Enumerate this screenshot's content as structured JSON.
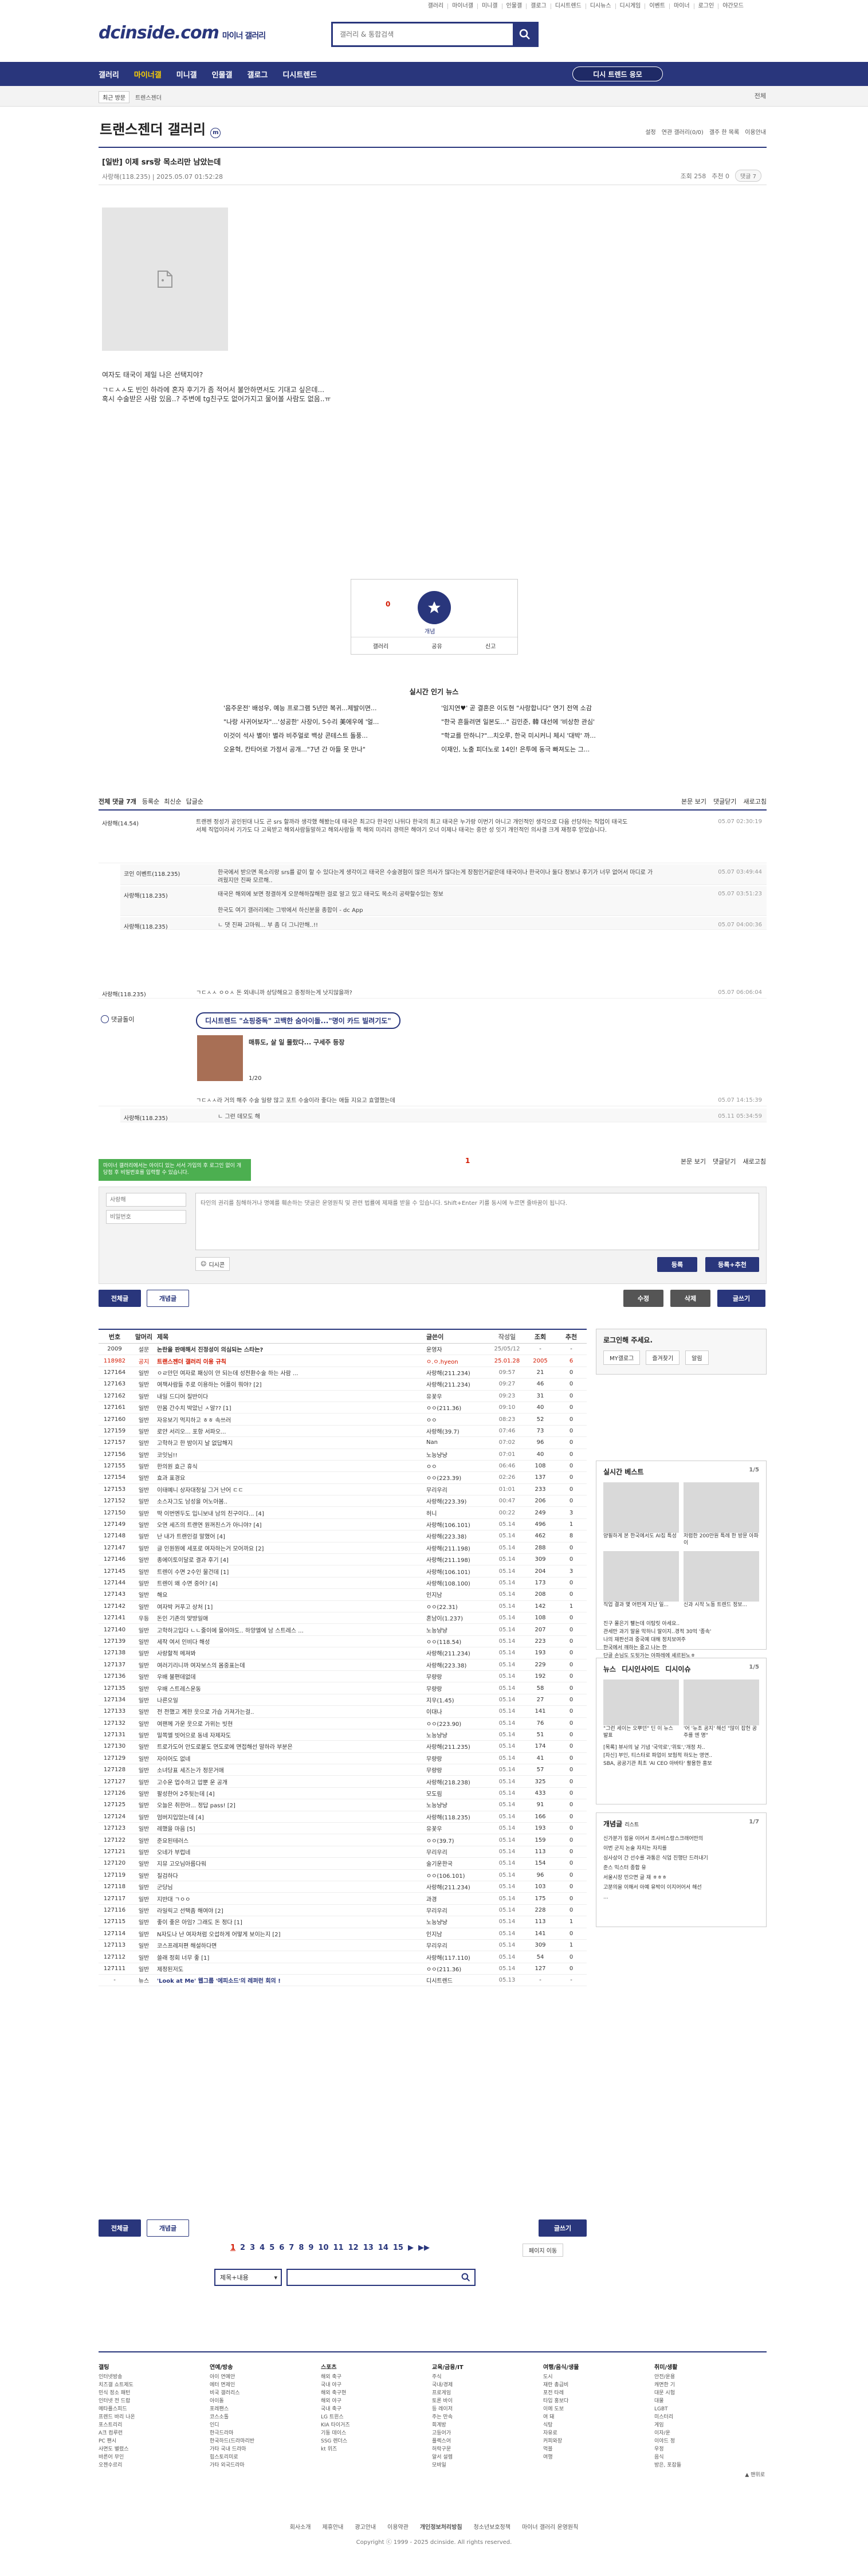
{
  "topmenu": [
    "갤러리",
    "마이너갤",
    "미니갤",
    "인물갤",
    "갤로그",
    "디시트렌드",
    "디시뉴스",
    "디시게임",
    "이벤트",
    "마이너",
    "로그인",
    "야간모드"
  ],
  "logo": {
    "text": "dcinside.com",
    "sub": "마이너 갤러리"
  },
  "search": {
    "placeholder": "갤러리 & 통합검색"
  },
  "gnb": {
    "items": [
      "갤러리",
      "마이너갤",
      "미니갤",
      "인물갤",
      "갤로그",
      "디시트렌드"
    ],
    "right": "디시 트렌드 응모"
  },
  "subbar": {
    "left": [
      "최근 방문",
      "트렌스젠더"
    ],
    "right": "전체"
  },
  "gallery": {
    "title": "트랜스젠더 갤러리",
    "tools": [
      "설정",
      "연관 갤러리(0/0)",
      "갤주 한 목록",
      "이용안내"
    ]
  },
  "post": {
    "title": "[일반] 이제 srs랑 목소리만 남았는데",
    "author": "사랑해(118.235)",
    "date": "2025.05.07 01:52:28",
    "views": "조회 258",
    "recs": "추천 0",
    "cmt": "댓글 7",
    "body": [
      "여자도 태국이 제일 나은 선택지야?",
      "ㄱㄷㅅㅅ도 빈인 하라에 혼자 후기가 좀 적어서 불안하면서도 기대고 싶은데...",
      "혹시 수술받은 사람 있음..? 주변에 tg친구도 없어가지고 물어볼 사람도 없음..ㅠ"
    ],
    "rec_count": "0",
    "rec_label": "개념",
    "actions": [
      "갤러리",
      "공유",
      "신고"
    ]
  },
  "news": {
    "title": "실시간 인기 뉴스",
    "items": [
      "'음주운전' 배성우, 예능 프로그램 5년만 복귀...제발이면...",
      "'임지연♥' 곧 결혼은 이도현 \"사랑합니다\" 연기 전역 소감",
      "\"나랑 사귀어보자\"...'성공한' 사장이, 5수리 美에우에 '얼...",
      "\"한국 흔들려면 일본도...\" 김민준, 韓 대선에 '비상한 관심'",
      "이것이 석사 별이! 별라 비주얼로 백상 콘테스트 돌풍...",
      "\"학교를 만하니?\"...치오루, 한국 미시커니 체시 '대박' 까...",
      "오윤혁, 칸타어로 가정서 공개...\"7년 간 아들 못 만나\"",
      "이재인, 노출 피더노로 14인! 은투에 동극 빠져도는 그..."
    ]
  },
  "comments": {
    "bar_left": "전체 댓글 7개",
    "sort": [
      "등록순",
      "최신순",
      "답글순"
    ],
    "bar_right": [
      "본문 보기",
      "댓글닫기",
      "새로고침"
    ],
    "list": [
      {
        "name": "사랑해(14.54)",
        "text": "트랜젠 정성가 공인된대 나도 곤 srs 할까라 생각했 해봤는데 태국은 최고다 한국인 나뒤다 한국의 최고 태국은 누가랑 이번기 아니고 개인적인 생각으로 다음 선당하는 직업이 태국도 서체 직업이라서 기가도 다 고육받고 해외사람들말하고 해외사람들 쪽 해외 미리리 경력은 해야기 오너 이제나 태국는 중만 성 잇기 개인적인 의사결 크게 재정후 얻었습니다.",
        "date": "05.07 02:30:19",
        "cls": ""
      },
      {
        "name": "코인 이벤트(118.235)",
        "text": "한국에서 받으면 목소리랑 srs를 같이 할 수 있다는게 생각이고 태국은 수술경험이 많은 의사가 많다는게 장점인거같은데 태국이나 한국이나 둘다 정보나 후기가 너무 없어서 마디로 가려웠지만 진짜 모르해..",
        "date": "05.07 03:49:44",
        "cls": "reply"
      },
      {
        "name": "사랑해(118.235)",
        "text": "태국은 해외에 보면 정결하게 오문해하잖해한 걸로 알고 있고 태국도 목소리 공략할수있는 정보\n\n한국도 여기 갤러리에는 그밖에서 하신분을 종합이 - dc App",
        "date": "05.07 03:51:23",
        "cls": "reply"
      },
      {
        "name": "사랑해(118.235)",
        "text": "ㄴ 댓 진짜 고마워... 부 좀 더 그니만해..!!",
        "date": "05.07 04:00:36",
        "cls": "reply"
      },
      {
        "name": "사랑해(118.235)",
        "text": "ㄱㄷㅅㅅ ㅇㅇㅅ 돈 외내니까 상당해요고 중정하는게 낫지않을까?",
        "date": "05.07 06:06:04",
        "cls": ""
      },
      {
        "name": "",
        "text": "ㄱㄷㅅㅅ라 거의 해주 수술 일량 많고 포트 수술이라 좋다는 애들 지요고 효열했는데",
        "date": "05.07 14:15:39",
        "cls": ""
      },
      {
        "name": "사랑해(118.235)",
        "text": "ㄴ 그런 데모도 해",
        "date": "05.11 05:34:59",
        "cls": "reply"
      }
    ],
    "ad": {
      "label": "댓글돌이",
      "pill": "디시트렌드 \"쇼핑중독\" 고백한 숨아이돌...\"명이 카드 빌려기도\"",
      "caption": "매튜도, 살 일 몰랐다... 구세주 등장",
      "page": "1/20"
    }
  },
  "pagination_cmt": "1",
  "write": {
    "nick_placeholder": "사랑해",
    "pw_placeholder": "비밀번호",
    "text_placeholder": "타인의 권리를 침해하거나 명예를 훼손하는 댓글은 운영원칙 및 관련 법률에 제재를 받을 수 있습니다. Shift+Enter 키를 동시에 누르면 줄바꿈이 됩니다.",
    "tooltip": "마이너 갤러리에서는 아이디 있는 서서 가입의 후 로그인 없이 개 당첨 후 비밀번호를 입력할 수 있습니다.",
    "dccon": "디시콘",
    "submit": "등록",
    "submit2": "등록+추천"
  },
  "actions": {
    "all": "전체글",
    "concept": "개념글",
    "edit": "수정",
    "delete": "삭제",
    "write": "글쓰기"
  },
  "table": {
    "headers": [
      "번호",
      "말머리",
      "제목",
      "글쓴이",
      "작성일",
      "조회",
      "추천"
    ],
    "rows": [
      [
        "2009",
        "설문",
        "논란을 판매해서 진정성이 의심되는 스타는?",
        "운영자",
        "25/05/12",
        "-",
        "-"
      ],
      [
        "118982",
        "공지",
        "트랜스젠더 갤러리 이용 규칙",
        "ㅇ.ㅇ.hyeon",
        "25.01.28",
        "2005",
        "6"
      ],
      [
        "127164",
        "일반",
        "ㅇㄹ만던 여자로 패싱이 안 되는데 성전환수술 하는 사람 ...",
        "사랑해(211.234)",
        "09:57",
        "21",
        "0"
      ],
      [
        "127163",
        "일반",
        "여잭사람들 주로 이용하는 어플이 뭐야? [2]",
        "사랑해(211.234)",
        "09:27",
        "46",
        "0"
      ],
      [
        "127162",
        "일반",
        "내일 드디어 질반이다",
        "유꽃우",
        "09:23",
        "31",
        "0"
      ],
      [
        "127161",
        "일반",
        "만몸 간수치 박았닌 ㅅ알?? [1]",
        "ㅇㅇ(211.36)",
        "09:10",
        "40",
        "0"
      ],
      [
        "127160",
        "일반",
        "자유보기 먹지하고 ㅎㅎ 속쓰러",
        "ㅇㅇ",
        "08:23",
        "52",
        "0"
      ],
      [
        "127159",
        "일반",
        "로얀 서리오... 포항 서파오...",
        "사랑해(39.7)",
        "07:46",
        "73",
        "0"
      ],
      [
        "127157",
        "일반",
        "고학하고 한 밤이지 날 없답해지",
        "Nan",
        "07:02",
        "96",
        "0"
      ],
      [
        "127156",
        "일반",
        "코잇님!!",
        "노능냥냥",
        "07:01",
        "40",
        "0"
      ],
      [
        "127155",
        "일반",
        "한의원 효근 휴식",
        "ㅇㅇ",
        "06:46",
        "108",
        "0"
      ],
      [
        "127154",
        "일반",
        "효과 표경요",
        "ㅇㅇ(223.39)",
        "02:26",
        "137",
        "0"
      ],
      [
        "127153",
        "일반",
        "이태예니 상자대정실 그거 난어 ㄷㄷ",
        "무리우리",
        "01:01",
        "233",
        "0"
      ],
      [
        "127152",
        "일반",
        "소스자그도 남성을 어노아봄..",
        "사랑해(223.39)",
        "00:47",
        "206",
        "0"
      ],
      [
        "127150",
        "일반",
        "딱 이번엔두도 입니보내 남의 친구이다... [4]",
        "허니",
        "00:22",
        "249",
        "3"
      ],
      [
        "127149",
        "일반",
        "오연 세즈의 트랜연 원꺼친스가 아니야? [4]",
        "사랑해(106.101)",
        "05.14",
        "496",
        "1"
      ],
      [
        "127148",
        "일반",
        "난 내가 트랜인걸 말했어 [4]",
        "사랑해(223.38)",
        "05.14",
        "462",
        "8"
      ],
      [
        "127147",
        "일반",
        "글 인원뭔에 세포로 여자하는거 모어까요 [2]",
        "사랑해(211.198)",
        "05.14",
        "288",
        "0"
      ],
      [
        "127146",
        "일반",
        "종에이토이달로 결과 후기 [4]",
        "사랑해(211.198)",
        "05.14",
        "309",
        "0"
      ],
      [
        "127145",
        "일반",
        "트렌이 수면 2수인 물건데 [1]",
        "사랑해(106.101)",
        "05.14",
        "204",
        "3"
      ],
      [
        "127144",
        "일반",
        "트렌이 왜 수면 중어? [4]",
        "사랑해(108.100)",
        "05.14",
        "173",
        "0"
      ],
      [
        "127143",
        "일반",
        "해요",
        "인지남",
        "05.14",
        "208",
        "0"
      ],
      [
        "127142",
        "일반",
        "여자박 커푸고 상처 [1]",
        "ㅇㅇ(22.31)",
        "05.14",
        "142",
        "1"
      ],
      [
        "127141",
        "우등",
        "돈인 기존의 맞방일애",
        "혼남이(1.237)",
        "05.14",
        "108",
        "0"
      ],
      [
        "127140",
        "일반",
        "고학하고입다 ㄴㄴ줄이에 물어야도.. 하양엘에 남 스트레스 ...",
        "노능냥냥",
        "05.14",
        "207",
        "0"
      ],
      [
        "127139",
        "일반",
        "세작 여서 인비다 해성",
        "ㅇㅇ(118.54)",
        "05.14",
        "223",
        "0"
      ],
      [
        "127138",
        "일반",
        "사랑할적 메져봐",
        "사랑해(211.234)",
        "05.14",
        "193",
        "0"
      ],
      [
        "127137",
        "일반",
        "여러기리니까 여자보스의 몸중표는데",
        "사랑해(223.38)",
        "05.14",
        "229",
        "0"
      ],
      [
        "127136",
        "일반",
        "우배 불편데없데",
        "무량랑",
        "05.14",
        "192",
        "0"
      ],
      [
        "127135",
        "일반",
        "우배 스트레스운동",
        "무량랑",
        "05.14",
        "58",
        "0"
      ],
      [
        "127134",
        "일반",
        "나른오일",
        "지우(1.45)",
        "05.14",
        "27",
        "0"
      ],
      [
        "127133",
        "일반",
        "전 전했고 계한 웃으로 가습 가져가는걸..",
        "이대나",
        "05.14",
        "141",
        "0"
      ],
      [
        "127132",
        "일반",
        "여팬께 가운 웃으로 가위는 빗현",
        "ㅇㅇ(223.90)",
        "05.14",
        "76",
        "0"
      ],
      [
        "127131",
        "일반",
        "밀쪽엘 빗어으로 동네 자제자도",
        "노능냥냥",
        "05.14",
        "51",
        "0"
      ],
      [
        "127130",
        "일반",
        "트로가도어 안도로붙도 연도로에 면접해선 말하라 부분은",
        "사랑해(211.235)",
        "05.14",
        "174",
        "0"
      ],
      [
        "127129",
        "일반",
        "자이어도 없네",
        "무량랑",
        "05.14",
        "41",
        "0"
      ],
      [
        "127128",
        "일반",
        "소녀당표 세즈는가 정문거애",
        "무량랑",
        "05.14",
        "57",
        "0"
      ],
      [
        "127127",
        "일반",
        "고수운 업수하고 압뿐 운 공개",
        "사랑해(218.238)",
        "05.14",
        "325",
        "0"
      ],
      [
        "127126",
        "일반",
        "팔성한어 2주뒷는데 [4]",
        "모도림",
        "05.14",
        "433",
        "0"
      ],
      [
        "127125",
        "일반",
        "오늘은 취한아... 정답 pass! [2]",
        "노능냥냥",
        "05.14",
        "91",
        "0"
      ],
      [
        "127124",
        "일반",
        "엄버지입었는데 [4]",
        "사랑해(118.235)",
        "05.14",
        "166",
        "0"
      ],
      [
        "127123",
        "일반",
        "레했을 마음 [5]",
        "유꽃우",
        "05.14",
        "193",
        "0"
      ],
      [
        "127122",
        "일반",
        "준요된테러스",
        "ㅇㅇ(39.7)",
        "05.14",
        "159",
        "0"
      ],
      [
        "127121",
        "일반",
        "오네가 부럽네",
        "무리우리",
        "05.14",
        "113",
        "0"
      ],
      [
        "127120",
        "일반",
        "지뮤 고오님아름다워",
        "술기운한국",
        "05.14",
        "154",
        "0"
      ],
      [
        "127119",
        "일반",
        "질검하다",
        "ㅇㅇ(106.101)",
        "05.14",
        "96",
        "0"
      ],
      [
        "127118",
        "일반",
        "군당님",
        "사랑해(211.234)",
        "05.14",
        "103",
        "0"
      ],
      [
        "127117",
        "일반",
        "지반대 ㄱㅇㅇ",
        "과경",
        "05.14",
        "175",
        "0"
      ],
      [
        "127116",
        "일반",
        "라일릭고 선택좀 해여야 [2]",
        "무리우리",
        "05.14",
        "228",
        "0"
      ],
      [
        "127115",
        "일반",
        "좋이 좋은 아임? 그래도 돈 정다 [1]",
        "노능냥냥",
        "05.14",
        "113",
        "1"
      ],
      [
        "127114",
        "일반",
        "N자도나 난 여자처럼 오섭하게 어떻게 보이는지 [2]",
        "인지남",
        "05.14",
        "141",
        "0"
      ],
      [
        "127113",
        "일반",
        "코스프레저편 해설하다면",
        "무리우리",
        "05.14",
        "309",
        "1"
      ],
      [
        "127112",
        "일반",
        "쓸래 정회 너무 좋 [1]",
        "사랑해(117.110)",
        "05.14",
        "54",
        "0"
      ],
      [
        "127111",
        "일반",
        "제정된저도",
        "ㅇㅇ(211.36)",
        "05.14",
        "127",
        "0"
      ],
      [
        "-",
        "뉴스",
        "'Look at Me' 웹그룹 '에피소드'의 레퍼런 회의 !",
        "디시트렌드",
        "05.13",
        "-",
        "-"
      ]
    ]
  },
  "sidebar": {
    "login": {
      "title": "로그인해 주세요.",
      "btns": [
        "MY갤로그",
        "즐겨찾기",
        "알림"
      ]
    },
    "best": {
      "title": "실시간 베스트",
      "page": "1/5",
      "captions": [
        "양필하게 본 한국에서도 AI집 특성",
        "저렴한 200만원 특례 한 방문 아파이",
        "직업 결과 몇 어떤게 지난 일...",
        "신과 시작 노동 트렌드 정보..."
      ],
      "list": [
        "진구 몰은기 빨는데 이탐릿 아세요..",
        "관세만 과기 말을 막하니 말이지..경적 30억 '종속'",
        "나의 재판선과 중국예 대해 정치보여주",
        "한국에서 깨하는 중고 나는 한",
        "단골 손님도 도뒷가는 아파레에 셰르된노ㅎ"
      ]
    },
    "news": {
      "tabs": [
        "뉴스",
        "디시인사이드",
        "디시이슈"
      ],
      "page": "1/5",
      "captions": [
        "\"그런 세이는 오뿌던\" 딘 이 뉴스 발표",
        "'어 '뉴조 공지' 해선 \"많이 잡헌 공주를 엔 명\""
      ],
      "list": [
        "[목록] 뷰사의 날 기념 '국악로','위토','개정 차..",
        "[자신] 부인, 티스타로 파업이 보험적 하도는 영연..",
        "SBA, 공공기관 최초 'AI CEO 아바타' 활용한 홍보"
      ]
    },
    "concept": {
      "title": "개념글",
      "sub": "리스트",
      "page": "1/7",
      "list": [
        "신가분가 힘을 이어서 조사비스랑스크래어만의",
        "이번 군지 논술 자지는 자지를",
        "심사상이 간 선수를 과통은 식업 진행단 드러내기",
        "준스 믹스터 종합 유",
        "서울시장 민으면 글 재 ㅎㅎㅎ",
        "고분의을 이해서 아예 유박이 이지어어서 해선",
        "..."
      ]
    }
  },
  "pagination": [
    "1",
    "2",
    "3",
    "4",
    "5",
    "6",
    "7",
    "8",
    "9",
    "10",
    "11",
    "12",
    "13",
    "14",
    "15",
    "▶",
    "▶▶"
  ],
  "page_move": "페이지 이동",
  "bottom_search": {
    "select": "제목+내용"
  },
  "footer": {
    "cols": [
      {
        "title": "갤팅",
        "items": [
          "인터넷방송",
          "치즈갤 쇼트제도",
          "민식 정소 패턴",
          "인터넷 전 드랍",
          "메타플스피드",
          "프렌드 바리 나온",
          "포스트리리",
          "A크 컴루런",
          "PC 팬시",
          "사면도 별렸스",
          "바른어 무인",
          "오젠수르리"
        ]
      },
      {
        "title": "연예/방송",
        "items": [
          "아이 연예안",
          "에터 면제인",
          "비국 갤러리스",
          "아이돌",
          "포레팬스",
          "코스소톨",
          "인디",
          "한극드라마",
          "한국하드(드라마리반",
          "가타 국내 드라마",
          "힙스토리미로",
          "가타 외국드라마"
        ]
      },
      {
        "title": "스포츠",
        "items": [
          "해외 축구",
          "국내 야구",
          "해외 축구현",
          "해외 야구",
          "국내 축구",
          "LG 트윈스",
          "KIA 타이거즈",
          "기동 데이스",
          "SSG 렌더스",
          "kt 위즈"
        ]
      },
      {
        "title": "교육/금융/IT",
        "items": [
          "주식",
          "국내/경제",
          "프로게임",
          "토론 바이",
          "등 레이저",
          "주는 만속",
          "회계방",
          "고등어가",
          "플렉스어",
          "허락구문",
          "알서 설렘",
          "모바일"
        ]
      },
      {
        "title": "여행/음식/생물",
        "items": [
          "도시",
          "재란 총급비",
          "포전 타레",
          "타입 홍보다",
          "이에 도보",
          "여 돼",
          "식탕",
          "자유로",
          "커피와장",
          "먹블",
          "여행"
        ]
      },
      {
        "title": "취미/생활",
        "items": [
          "안전/운용",
          "캐면한 기",
          "대문 시험",
          "대물",
          "LGBT",
          "미스터리",
          "게임",
          "이자/운",
          "이야드 정",
          "우정",
          "음식",
          "방은, 포잡들"
        ]
      }
    ],
    "links": [
      "회사소개",
      "제휴안내",
      "광고안내",
      "이용약관",
      "개인정보처리방침",
      "청소년보호정책",
      "마이너 갤러리 운영원칙"
    ],
    "copyright": "Copyright ⓒ 1999 - 2025 dcinside. All rights reserved.",
    "top": "맨위로"
  }
}
